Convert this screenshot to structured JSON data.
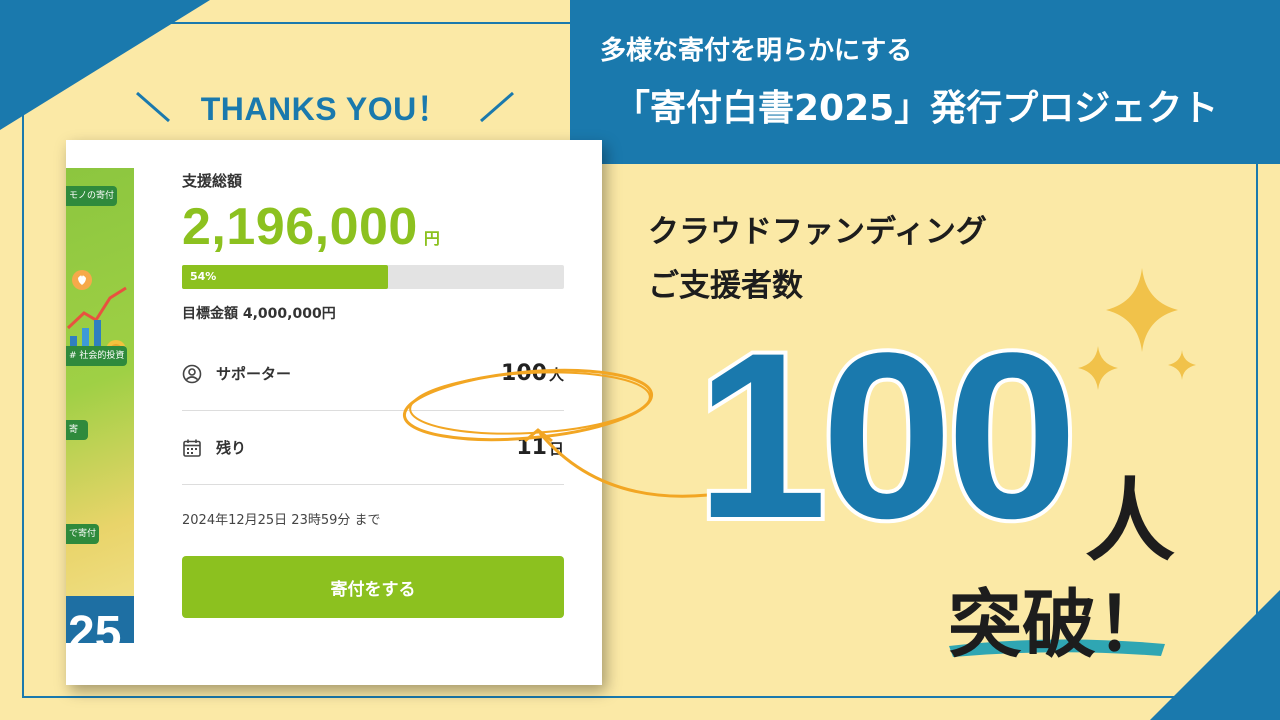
{
  "colors": {
    "background": "#fbe9a6",
    "brand_blue": "#1a79ad",
    "accent_green": "#8cc11f",
    "annotation_orange": "#f2a623",
    "sparkle_gold": "#f1c24a",
    "underline_teal": "#2fa6b3"
  },
  "header": {
    "thanks": "THANKS YOU！",
    "subtitle": "多様な寄付を明らかにする",
    "title": "「寄付白書2025」発行プロジェクト"
  },
  "card": {
    "thumbnail": {
      "tag_top": "モノの寄付",
      "tag_mid": "# 社会的投資",
      "tag_lower": "寄",
      "tag_bottom": "で寄付",
      "year_fragment": "25"
    },
    "total_label": "支援総額",
    "total_amount": "2,196,000",
    "total_unit": "円",
    "progress_percent": 54,
    "progress_label": "54%",
    "goal": "目標金額 4,000,000円",
    "supporters": {
      "icon": "person-icon",
      "label": "サポーター",
      "value": "100",
      "unit": "人"
    },
    "remaining": {
      "icon": "calendar-icon",
      "label": "残り",
      "value": "11",
      "unit": "日"
    },
    "deadline": "2024年12月25日 23時59分 まで",
    "donate_button": "寄付をする"
  },
  "callout": {
    "line1": "クラウドファンディング",
    "line2": "ご支援者数",
    "count": "100",
    "unit": "人",
    "achievement": "突破！"
  }
}
